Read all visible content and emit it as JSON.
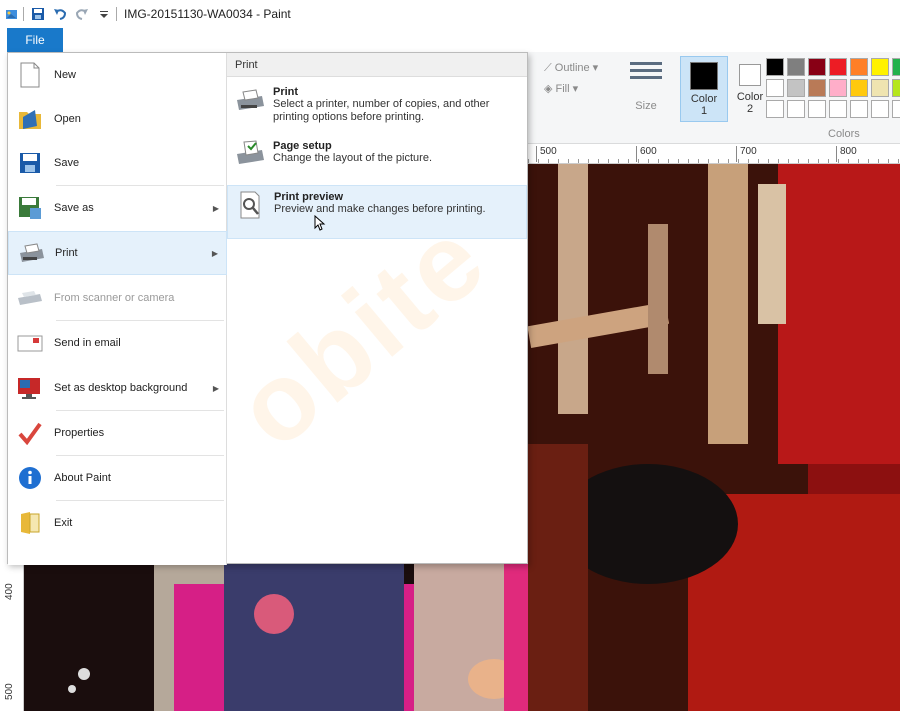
{
  "window": {
    "title": "IMG-20151130-WA0034 - Paint"
  },
  "quick_access": {
    "icons": [
      "paint-app-icon",
      "save-icon",
      "undo-icon",
      "redo-icon",
      "customize-icon"
    ]
  },
  "file_tab": {
    "label": "File"
  },
  "file_menu": {
    "items": [
      {
        "label": "New",
        "icon": "new-file-icon"
      },
      {
        "label": "Open",
        "icon": "folder-icon"
      },
      {
        "label": "Save",
        "icon": "save-icon"
      },
      {
        "label": "Save as",
        "icon": "save-as-icon",
        "submenu": true
      },
      {
        "label": "Print",
        "icon": "printer-icon",
        "submenu": true,
        "active": true
      },
      {
        "label": "From scanner or camera",
        "icon": "scanner-icon",
        "disabled": true
      },
      {
        "label": "Send in email",
        "icon": "email-icon"
      },
      {
        "label": "Set as desktop background",
        "icon": "desktop-icon",
        "submenu": true
      },
      {
        "label": "Properties",
        "icon": "checkmark-icon"
      },
      {
        "label": "About Paint",
        "icon": "info-icon"
      },
      {
        "label": "Exit",
        "icon": "exit-icon"
      }
    ]
  },
  "print_submenu": {
    "header": "Print",
    "items": [
      {
        "title": "Print",
        "description": "Select a printer, number of copies, and other printing options before printing."
      },
      {
        "title": "Page setup",
        "description": "Change the layout of the picture."
      },
      {
        "title": "Print preview",
        "description": "Preview and make changes before printing."
      }
    ]
  },
  "ribbon": {
    "outline_label": "Outline",
    "fill_label": "Fill",
    "size_label": "Size",
    "color1_label": "Color",
    "color1_num": "1",
    "color2_label": "Color",
    "color2_num": "2",
    "colors_group_label": "Colors",
    "palette": [
      "#000000",
      "#7f7f7f",
      "#880015",
      "#ed1c24",
      "#ff7f27",
      "#fff200",
      "#22b14c",
      "#ffffff",
      "#c3c3c3",
      "#b97a57",
      "#ffaec9",
      "#ffc90e",
      "#efe4b0",
      "#b5e61d",
      "#ffffff",
      "#ffffff",
      "#ffffff",
      "#ffffff",
      "#ffffff",
      "#ffffff",
      "#ffffff"
    ]
  },
  "ruler": {
    "horizontal": [
      "500",
      "600",
      "700",
      "800"
    ],
    "vertical": [
      "400",
      "500"
    ]
  },
  "watermark": "obite"
}
